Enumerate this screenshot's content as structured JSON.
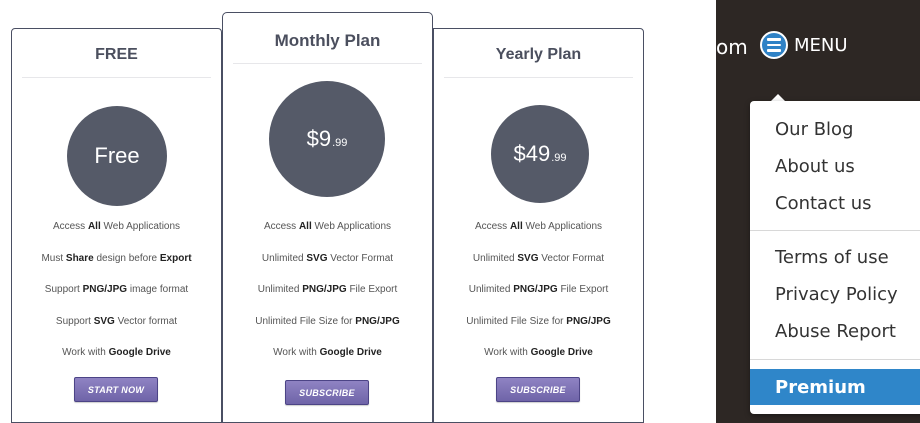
{
  "pricing": {
    "free": {
      "title": "FREE",
      "price": "Free",
      "features": [
        {
          "pre": "Access ",
          "bold": "All",
          "post": " Web Applications"
        },
        {
          "pre": "Must ",
          "bold": "Share",
          "post": " design before ",
          "bold2": "Export"
        },
        {
          "pre": "Support ",
          "bold": "PNG/JPG",
          "post": " image format"
        },
        {
          "pre": "Support ",
          "bold": "SVG",
          "post": " Vector format"
        },
        {
          "pre": "Work with ",
          "bold": "Google Drive",
          "post": ""
        }
      ],
      "button": "START NOW"
    },
    "monthly": {
      "title": "Monthly Plan",
      "price_main": "$9",
      "price_cents": ".99",
      "features": [
        {
          "pre": "Access ",
          "bold": "All",
          "post": " Web Applications"
        },
        {
          "pre": "Unlimited ",
          "bold": "SVG",
          "post": " Vector Format"
        },
        {
          "pre": "Unlimited ",
          "bold": "PNG/JPG",
          "post": " File Export"
        },
        {
          "pre": "Unlimited File Size for ",
          "bold": "PNG/JPG",
          "post": ""
        },
        {
          "pre": "Work with ",
          "bold": "Google Drive",
          "post": ""
        }
      ],
      "button": "SUBSCRIBE"
    },
    "yearly": {
      "title": "Yearly Plan",
      "price_main": "$49",
      "price_cents": ".99",
      "features": [
        {
          "pre": "Access ",
          "bold": "All",
          "post": " Web Applications"
        },
        {
          "pre": "Unlimited ",
          "bold": "SVG",
          "post": " Vector Format"
        },
        {
          "pre": "Unlimited ",
          "bold": "PNG/JPG",
          "post": " File Export"
        },
        {
          "pre": "Unlimited File Size for ",
          "bold": "PNG/JPG",
          "post": ""
        },
        {
          "pre": "Work with ",
          "bold": "Google Drive",
          "post": ""
        }
      ],
      "button": "SUBSCRIBE"
    }
  },
  "nav": {
    "site_fragment": "om",
    "menu_icon": "hamburger-icon",
    "menu_label": "MENU",
    "items": [
      "Our Blog",
      "About us",
      "Contact us",
      "Terms of use",
      "Privacy Policy",
      "Abuse Report"
    ],
    "premium": "Premium"
  },
  "colors": {
    "circle": "#555a68",
    "button": "#7a6fb5",
    "premium_highlight": "#2f86c9",
    "menu_background": "#2d2724"
  }
}
